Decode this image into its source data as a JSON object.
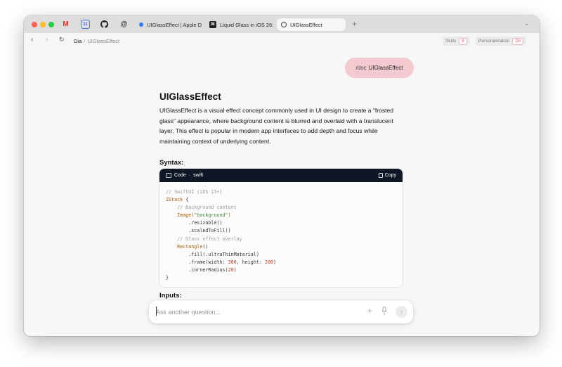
{
  "browser": {
    "tabs": [
      {
        "label": "UIGlassEffect | Apple D"
      },
      {
        "label": "Liquid Glass in iOS 26:"
      },
      {
        "label": "UIGlassEffect"
      }
    ],
    "new_tab_label": "+",
    "favicons": [
      "gmail-icon",
      "calendar-icon",
      "github-icon",
      "threads-icon"
    ]
  },
  "toolbar": {
    "breadcrumb_root": "Dia",
    "breadcrumb_sep": "/",
    "breadcrumb_current": "UIGlassEffect",
    "skills_label": "Skills",
    "skills_count": "9",
    "personalization_label": "Personalization",
    "personalization_state": "On"
  },
  "chat": {
    "user_command": "/doc",
    "user_query": "UIGlassEffect",
    "heading": "UIGlassEffect",
    "paragraph": "UIGlassEffect is a visual effect concept commonly used in UI design to create a “frosted glass” appearance, where background content is blurred and overlaid with a translucent layer. This effect is popular in modern app interfaces to add depth and focus while maintaining context of underlying content.",
    "syntax_heading": "Syntax:",
    "code_label": "Code",
    "code_sep": "·",
    "code_lang": "swift",
    "copy_label": "Copy",
    "inputs_heading": "Inputs:"
  },
  "code_lines": {
    "l1": "// SwiftUI (iOS 15+)",
    "l2a": "ZStack",
    "l2b": " {",
    "l3": "    // Background content",
    "l4a": "    Image(",
    "l4b": "\"background\"",
    "l4c": ")",
    "l5": "        .resizable()",
    "l6": "        .scaledToFill()",
    "l7": "    // Glass effect overlay",
    "l8a": "    Rectangle",
    "l8b": "()",
    "l9": "        .fill(.ultraThinMaterial)",
    "l10a": "        .frame(width: ",
    "l10b": "300",
    "l10c": ", height: ",
    "l10d": "200",
    "l10e": ")",
    "l11a": "        .cornerRadius(",
    "l11b": "20",
    "l11c": ")",
    "l12": "}"
  },
  "ask": {
    "placeholder": "Ask another question...",
    "value": ""
  },
  "colors": {
    "user_bubble": "#f4c9cf",
    "code_header": "#0f1726",
    "badge_text": "#d75560"
  }
}
